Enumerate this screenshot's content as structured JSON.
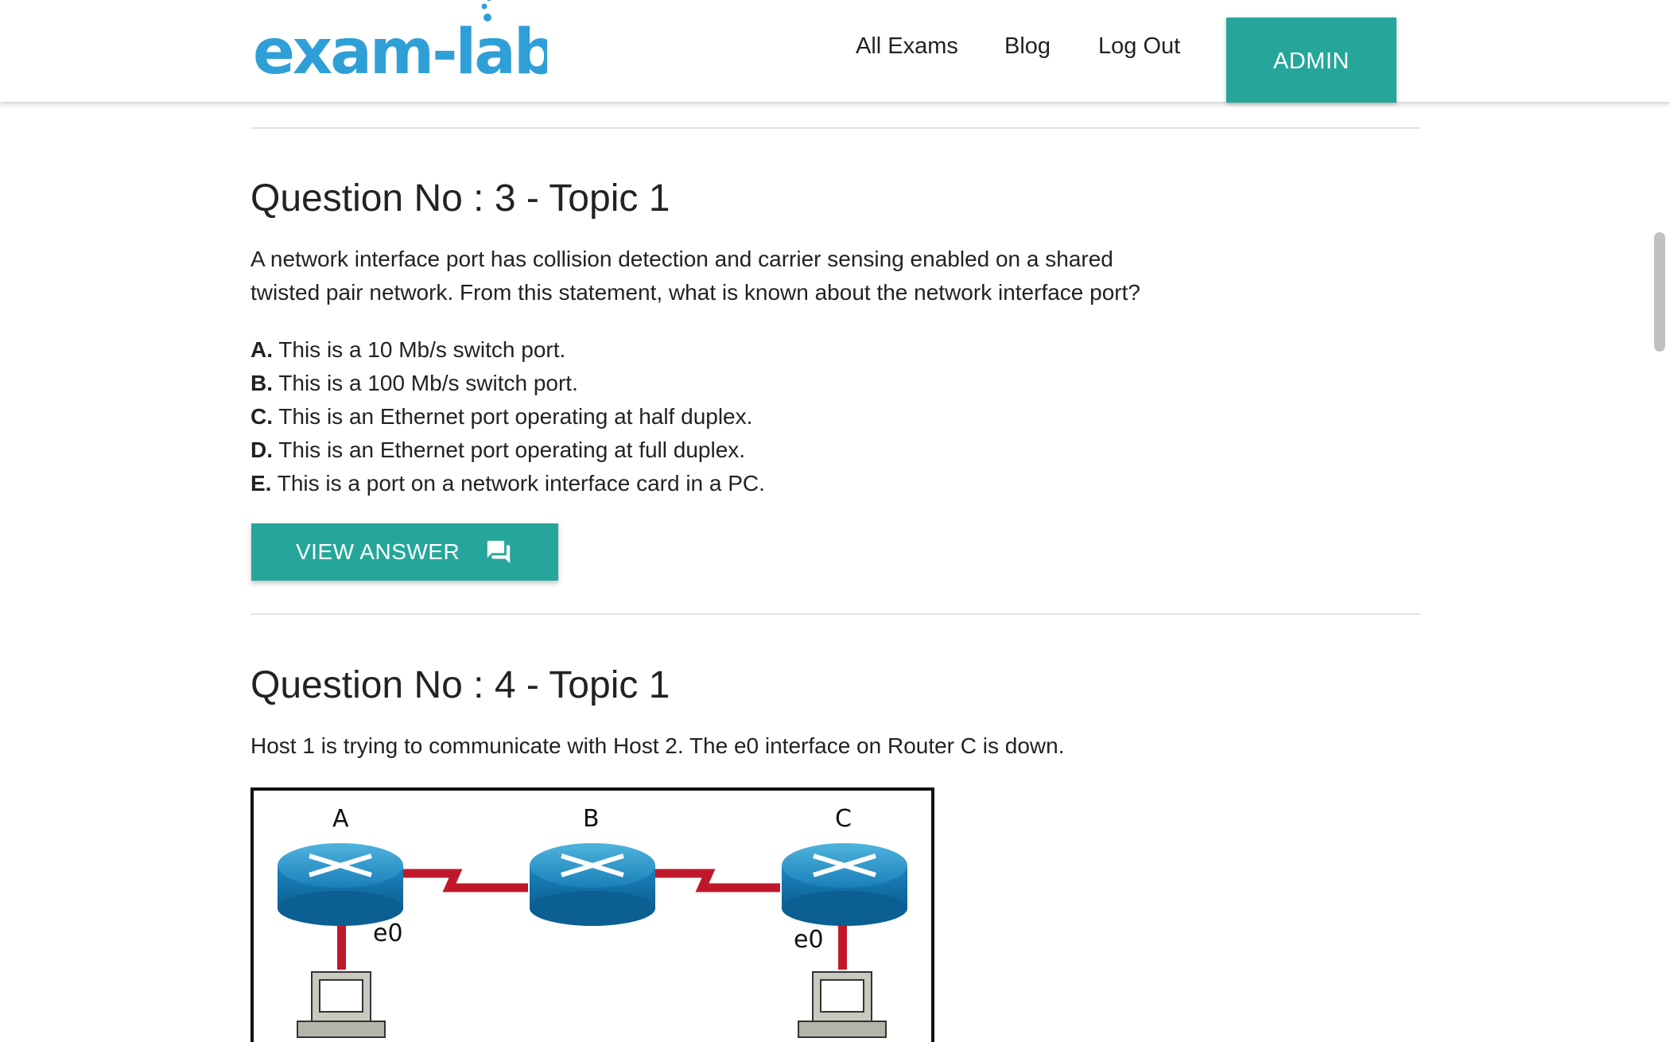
{
  "header": {
    "logo_text": "exam-labs",
    "nav": {
      "all_exams": "All Exams",
      "blog": "Blog",
      "log_out": "Log Out",
      "admin": "ADMIN"
    }
  },
  "colors": {
    "accent": "#26a69a",
    "logo_blue": "#2f9fd8",
    "link_red": "#c8102e"
  },
  "question3": {
    "title": "Question No : 3 - Topic 1",
    "text_line1": "A network interface port has collision detection and carrier sensing enabled on a shared",
    "text_line2": "twisted pair network. From this statement, what is known about the network interface port?",
    "options": [
      {
        "letter": "A.",
        "text": " This is a 10 Mb/s switch port."
      },
      {
        "letter": "B.",
        "text": " This is a 100 Mb/s switch port."
      },
      {
        "letter": "C.",
        "text": " This is an Ethernet port operating at half duplex."
      },
      {
        "letter": "D.",
        "text": " This is an Ethernet port operating at full duplex."
      },
      {
        "letter": "E.",
        "text": " This is a port on a network interface card in a PC."
      }
    ],
    "view_answer": "VIEW ANSWER",
    "view_answer_icon": "forum-icon"
  },
  "question4": {
    "title": "Question No : 4 - Topic 1",
    "text": "Host 1 is trying to communicate with Host 2. The e0 interface on Router C is down.",
    "diagram": {
      "router_a": "A",
      "router_b": "B",
      "router_c": "C",
      "iface_a": "e0",
      "iface_c": "e0"
    }
  }
}
